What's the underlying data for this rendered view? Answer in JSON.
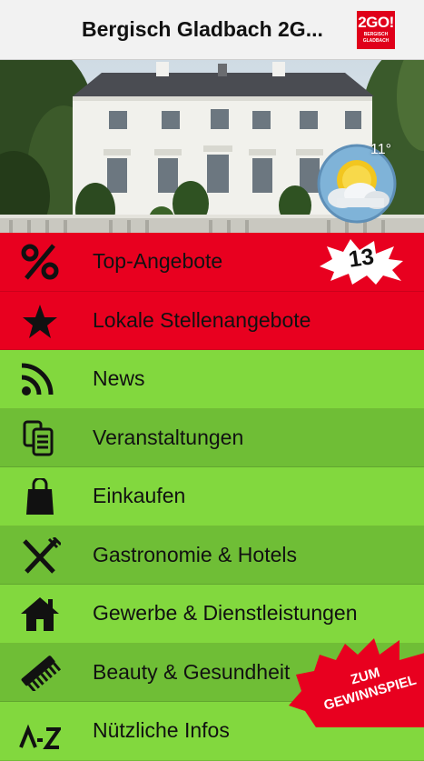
{
  "header": {
    "title": "Bergisch Gladbach 2G...",
    "logo_main": "2GO!",
    "logo_sub": "BERGISCH GLADBACH"
  },
  "weather": {
    "temperature": "11°",
    "icon": "partly-cloudy-icon"
  },
  "menu": [
    {
      "label": "Top-Angebote",
      "icon": "percent-icon",
      "badge": "13"
    },
    {
      "label": "Lokale Stellenangebote",
      "icon": "star-icon"
    },
    {
      "label": "News",
      "icon": "rss-icon"
    },
    {
      "label": "Veranstaltungen",
      "icon": "tickets-icon"
    },
    {
      "label": "Einkaufen",
      "icon": "shopping-bag-icon"
    },
    {
      "label": "Gastronomie & Hotels",
      "icon": "fork-knife-icon"
    },
    {
      "label": "Gewerbe & Dienstleistungen",
      "icon": "house-icon"
    },
    {
      "label": "Beauty & Gesundheit",
      "icon": "comb-icon"
    },
    {
      "label": "Nützliche Infos",
      "icon": "a-z-icon"
    }
  ],
  "promo": {
    "line1": "ZUM",
    "line2": "GEWINNSPIEL"
  },
  "colors": {
    "red": "#e8001f",
    "green_light": "#82d83e",
    "green_dark": "#6fbe36",
    "logo_red": "#e0001a"
  }
}
